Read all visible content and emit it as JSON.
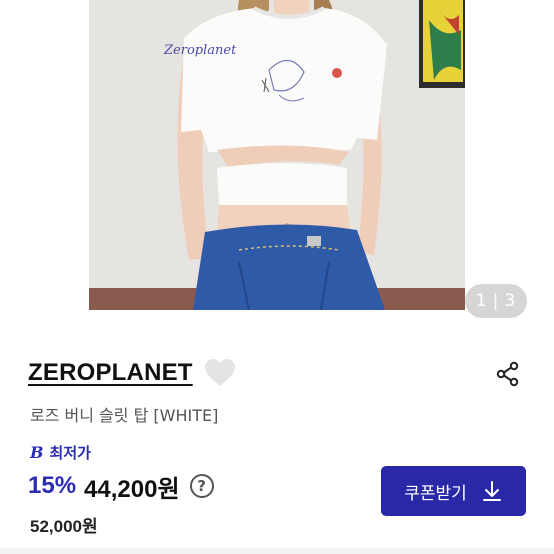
{
  "gallery": {
    "current": "1",
    "separator": "|",
    "total": "3",
    "print_text": "Zeroplanet"
  },
  "product": {
    "brand": "ZEROPLANET",
    "name": "로즈 버니 슬릿 탑 [WHITE]",
    "favorite": false
  },
  "pricing": {
    "lowest_mark": "B",
    "lowest_label": "최저가",
    "discount": "15%",
    "price": "44,200원",
    "help": "?",
    "original_price": "52,000원"
  },
  "coupon": {
    "label": "쿠폰받기"
  },
  "colors": {
    "accent": "#2929a8",
    "price_accent": "#2b2bb3"
  },
  "icons": {
    "favorite": "heart-icon",
    "share": "share-icon",
    "help": "question-circle-icon",
    "download": "download-arrow-icon"
  }
}
